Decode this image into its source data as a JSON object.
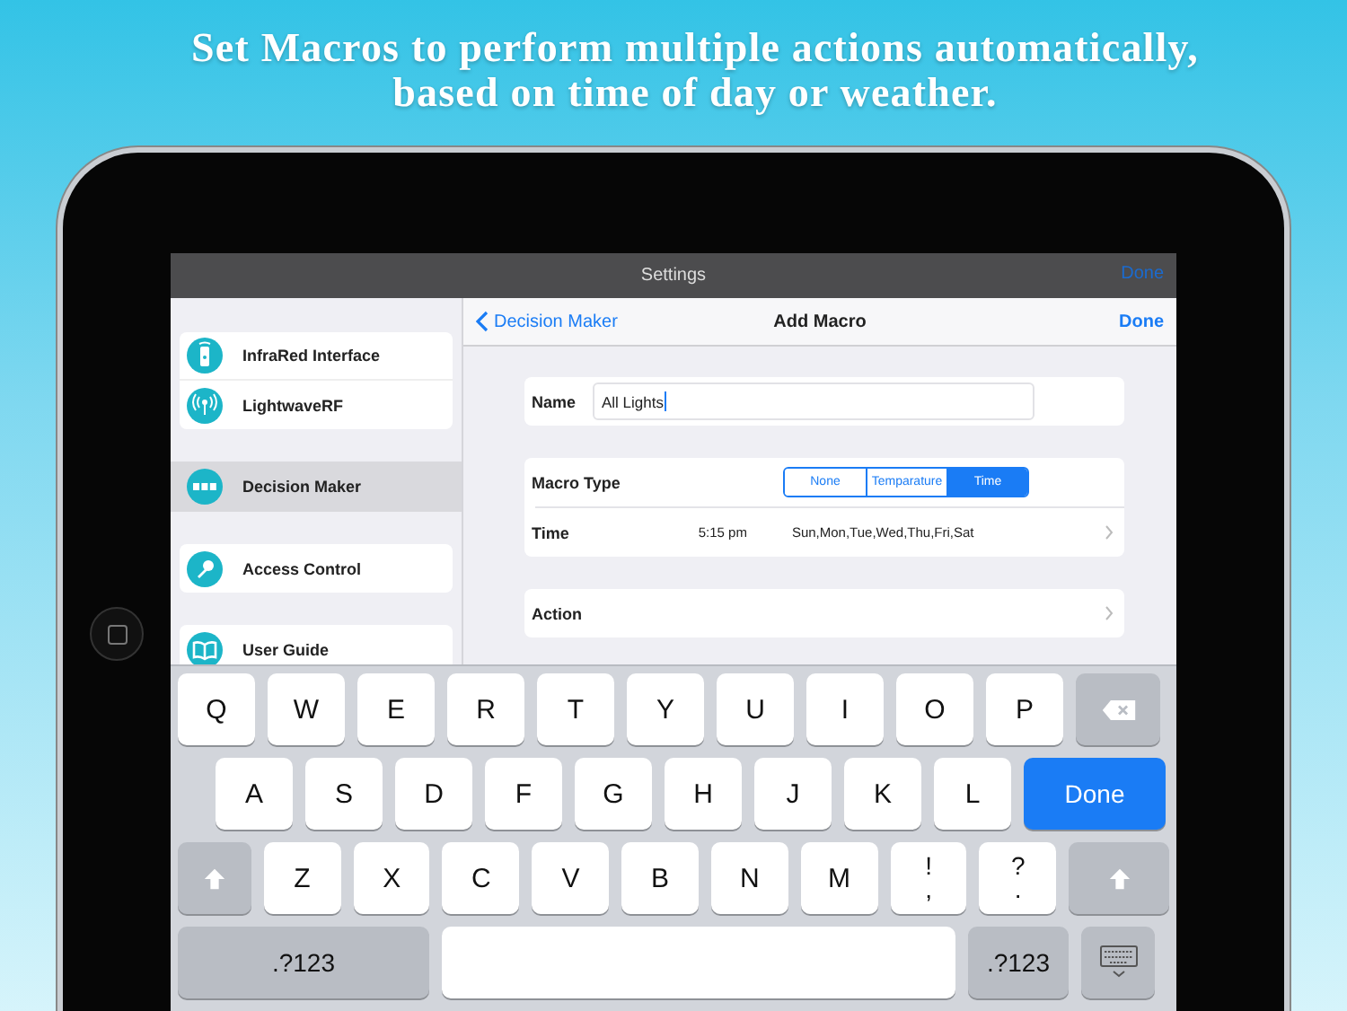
{
  "headline": {
    "lines": [
      "Set Macros to perform multiple actions automatically,",
      "based on time of day or weather."
    ]
  },
  "top_bar": {
    "title": "Settings",
    "action": "Done"
  },
  "sidebar": {
    "groups": [
      {
        "items": [
          {
            "label": "InfraRed Interface",
            "selected": false
          },
          {
            "label": "LightwaveRF",
            "selected": false
          }
        ]
      },
      {
        "items": [
          {
            "label": "Decision Maker",
            "selected": true
          }
        ]
      },
      {
        "items": [
          {
            "label": "Access Control",
            "selected": false
          }
        ]
      },
      {
        "items": [
          {
            "label": "User Guide",
            "selected": false
          }
        ]
      }
    ]
  },
  "nav_bar": {
    "back": "Decision Maker",
    "title": "Add Macro",
    "action": "Done"
  },
  "form": {
    "name": {
      "label": "Name",
      "value": "All Lights"
    },
    "macro_type": {
      "label": "Macro Type",
      "options": [
        {
          "label": "None",
          "selected": false
        },
        {
          "label": "Temparature",
          "selected": false
        },
        {
          "label": "Time",
          "selected": true
        }
      ]
    },
    "time": {
      "label": "Time",
      "value": "5:15 pm",
      "days": "Sun,Mon,Tue,Wed,Thu,Fri,Sat"
    },
    "action": {
      "label": "Action"
    }
  },
  "keyboard": {
    "rows": [
      {
        "keys": [
          {
            "kind": "letter",
            "label": "Q"
          },
          {
            "kind": "letter",
            "label": "W"
          },
          {
            "kind": "letter",
            "label": "E"
          },
          {
            "kind": "letter",
            "label": "R"
          },
          {
            "kind": "letter",
            "label": "T"
          },
          {
            "kind": "letter",
            "label": "Y"
          },
          {
            "kind": "letter",
            "label": "U"
          },
          {
            "kind": "letter",
            "label": "I"
          },
          {
            "kind": "letter",
            "label": "O"
          },
          {
            "kind": "letter",
            "label": "P"
          },
          {
            "kind": "backspace"
          }
        ]
      },
      {
        "keys": [
          {
            "kind": "letter",
            "label": "A"
          },
          {
            "kind": "letter",
            "label": "S"
          },
          {
            "kind": "letter",
            "label": "D"
          },
          {
            "kind": "letter",
            "label": "F"
          },
          {
            "kind": "letter",
            "label": "G"
          },
          {
            "kind": "letter",
            "label": "H"
          },
          {
            "kind": "letter",
            "label": "J"
          },
          {
            "kind": "letter",
            "label": "K"
          },
          {
            "kind": "letter",
            "label": "L"
          },
          {
            "kind": "done",
            "label": "Done"
          }
        ]
      },
      {
        "keys": [
          {
            "kind": "shift"
          },
          {
            "kind": "letter",
            "label": "Z"
          },
          {
            "kind": "letter",
            "label": "X"
          },
          {
            "kind": "letter",
            "label": "C"
          },
          {
            "kind": "letter",
            "label": "V"
          },
          {
            "kind": "letter",
            "label": "B"
          },
          {
            "kind": "letter",
            "label": "N"
          },
          {
            "kind": "letter",
            "label": "M"
          },
          {
            "kind": "punct",
            "label": "!",
            "sub": ","
          },
          {
            "kind": "punct",
            "label": "?",
            "sub": "."
          },
          {
            "kind": "shift-right"
          }
        ]
      },
      {
        "keys": [
          {
            "kind": "symbols-wide",
            "label": ".?123"
          },
          {
            "kind": "space"
          },
          {
            "kind": "symbols",
            "label": ".?123"
          },
          {
            "kind": "hide"
          }
        ]
      }
    ]
  }
}
